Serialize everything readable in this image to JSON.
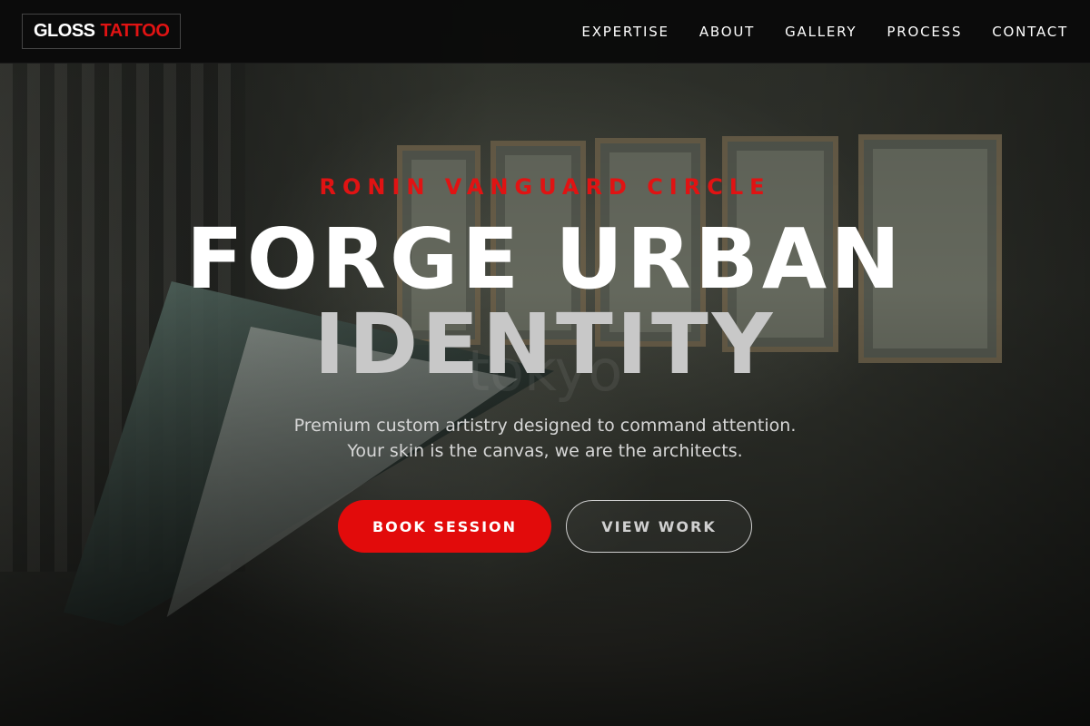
{
  "brand": {
    "logo_part1": "GLOSS",
    "logo_part2": "TATTOO",
    "accent_color": "#e01313"
  },
  "nav": {
    "items": [
      {
        "label": "EXPERTISE"
      },
      {
        "label": "ABOUT"
      },
      {
        "label": "GALLERY"
      },
      {
        "label": "PROCESS"
      },
      {
        "label": "CONTACT"
      }
    ]
  },
  "hero": {
    "eyebrow": "RONIN VANGUARD CIRCLE",
    "title_line1": "FORGE URBAN",
    "title_line2": "IDENTITY",
    "subtitle": "Premium custom artistry designed to command attention. Your skin is the canvas, we are the architects.",
    "watermark": "tokyo",
    "primary_cta": "BOOK SESSION",
    "secondary_cta": "VIEW WORK"
  }
}
